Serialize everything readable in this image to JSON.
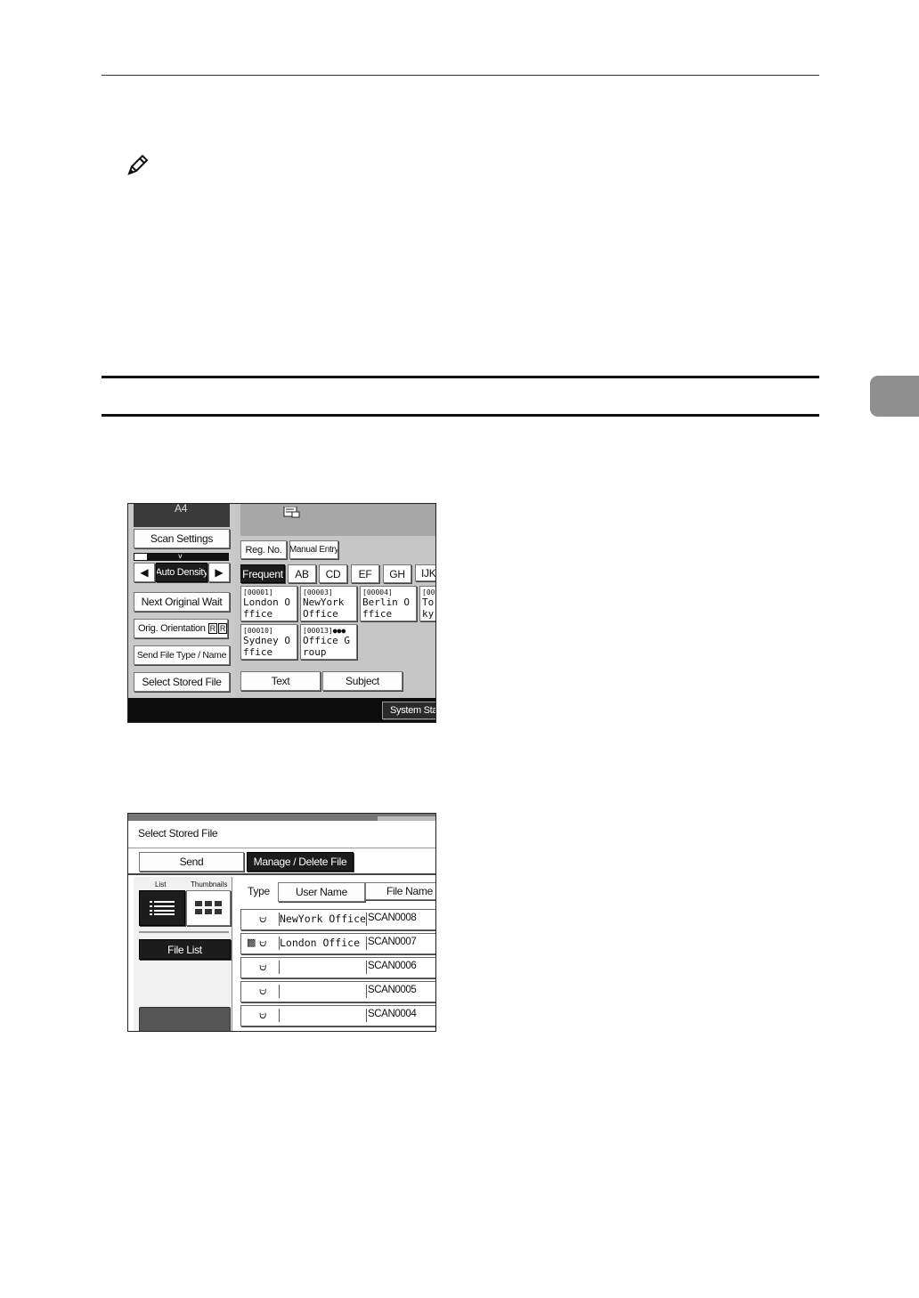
{
  "screen1": {
    "paper_label": "A4",
    "scan_settings": "Scan Settings",
    "auto_density": "Auto Density",
    "next_original_wait": "Next Original Wait",
    "orig_orientation": "Orig. Orientation",
    "send_file_type": "Send File Type / Name",
    "select_stored_file": "Select Stored File",
    "reg_no": "Reg. No.",
    "manual_entry": "Manual Entry",
    "tabs": [
      "Frequent",
      "AB",
      "CD",
      "EF",
      "GH",
      "IJK"
    ],
    "destinations": [
      {
        "code": "[00001]",
        "name": "London Office"
      },
      {
        "code": "[00003]",
        "name": "NewYork Office"
      },
      {
        "code": "[00004]",
        "name": "Berlin Office"
      },
      {
        "code": "[00",
        "name": "Tokyo Office"
      },
      {
        "code": "[00010]",
        "name": "Sydney Office"
      },
      {
        "code": "[00013]",
        "name": "Office Group"
      }
    ],
    "text_btn": "Text",
    "subject_btn": "Subject",
    "system_status": "System Status"
  },
  "screen2": {
    "title": "Select Stored File",
    "send_tab": "Send",
    "manage_tab": "Manage / Delete File",
    "list_label": "List",
    "thumb_label": "Thumbnails",
    "file_list": "File List",
    "col_type": "Type",
    "col_user": "User Name",
    "col_file": "File Name",
    "rows": [
      {
        "user": "NewYork Office",
        "file": "SCAN0008"
      },
      {
        "user": "London Office",
        "file": "SCAN0007"
      },
      {
        "user": "",
        "file": "SCAN0006"
      },
      {
        "user": "",
        "file": "SCAN0005"
      },
      {
        "user": "",
        "file": "SCAN0004"
      }
    ]
  }
}
